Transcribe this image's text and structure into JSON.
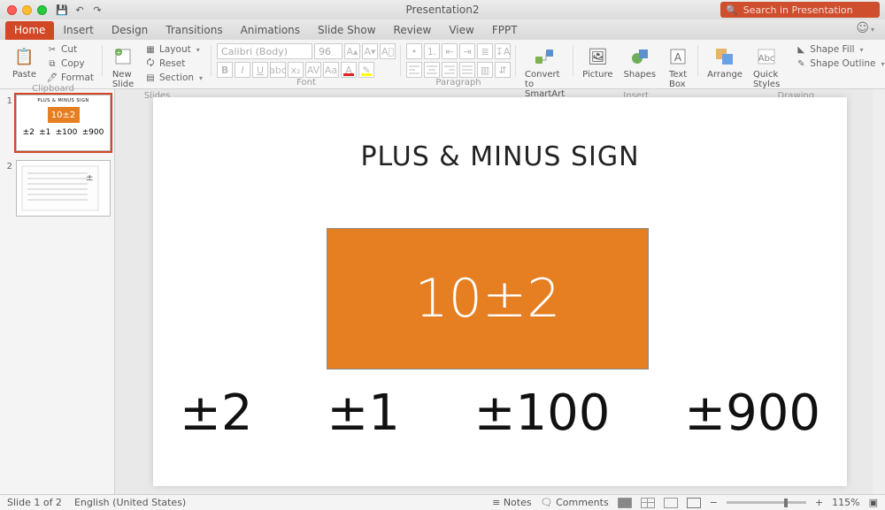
{
  "window": {
    "title": "Presentation2"
  },
  "search": {
    "placeholder": "Search in Presentation"
  },
  "tabs": {
    "home": "Home",
    "insert": "Insert",
    "design": "Design",
    "transitions": "Transitions",
    "animations": "Animations",
    "slideshow": "Slide Show",
    "review": "Review",
    "view": "View",
    "fppt": "FPPT"
  },
  "ribbon": {
    "clipboard": {
      "label": "Clipboard",
      "paste": "Paste",
      "cut": "Cut",
      "copy": "Copy",
      "format": "Format"
    },
    "slides": {
      "label": "Slides",
      "new": "New\nSlide",
      "layout": "Layout",
      "reset": "Reset",
      "section": "Section"
    },
    "font": {
      "label": "Font",
      "name": "Calibri (Body)",
      "size": "96"
    },
    "paragraph": {
      "label": "Paragraph"
    },
    "smartart": {
      "convert": "Convert to\nSmartArt"
    },
    "insert": {
      "label": "Insert",
      "picture": "Picture",
      "shapes": "Shapes",
      "textbox": "Text\nBox"
    },
    "arrange": {
      "label": "Arrange"
    },
    "quickstyles": {
      "label": "Quick\nStyles"
    },
    "drawing": {
      "label": "Drawing",
      "fill": "Shape Fill",
      "outline": "Shape Outline"
    }
  },
  "slide": {
    "title": "PLUS & MINUS SIGN",
    "box_text": "10±2",
    "items": [
      "±2",
      "±1",
      "±100",
      "±900"
    ]
  },
  "thumbs": {
    "n1": "1",
    "n2": "2"
  },
  "status": {
    "slide": "Slide 1 of 2",
    "lang": "English (United States)",
    "notes": "Notes",
    "comments": "Comments",
    "zoom": "115%"
  }
}
